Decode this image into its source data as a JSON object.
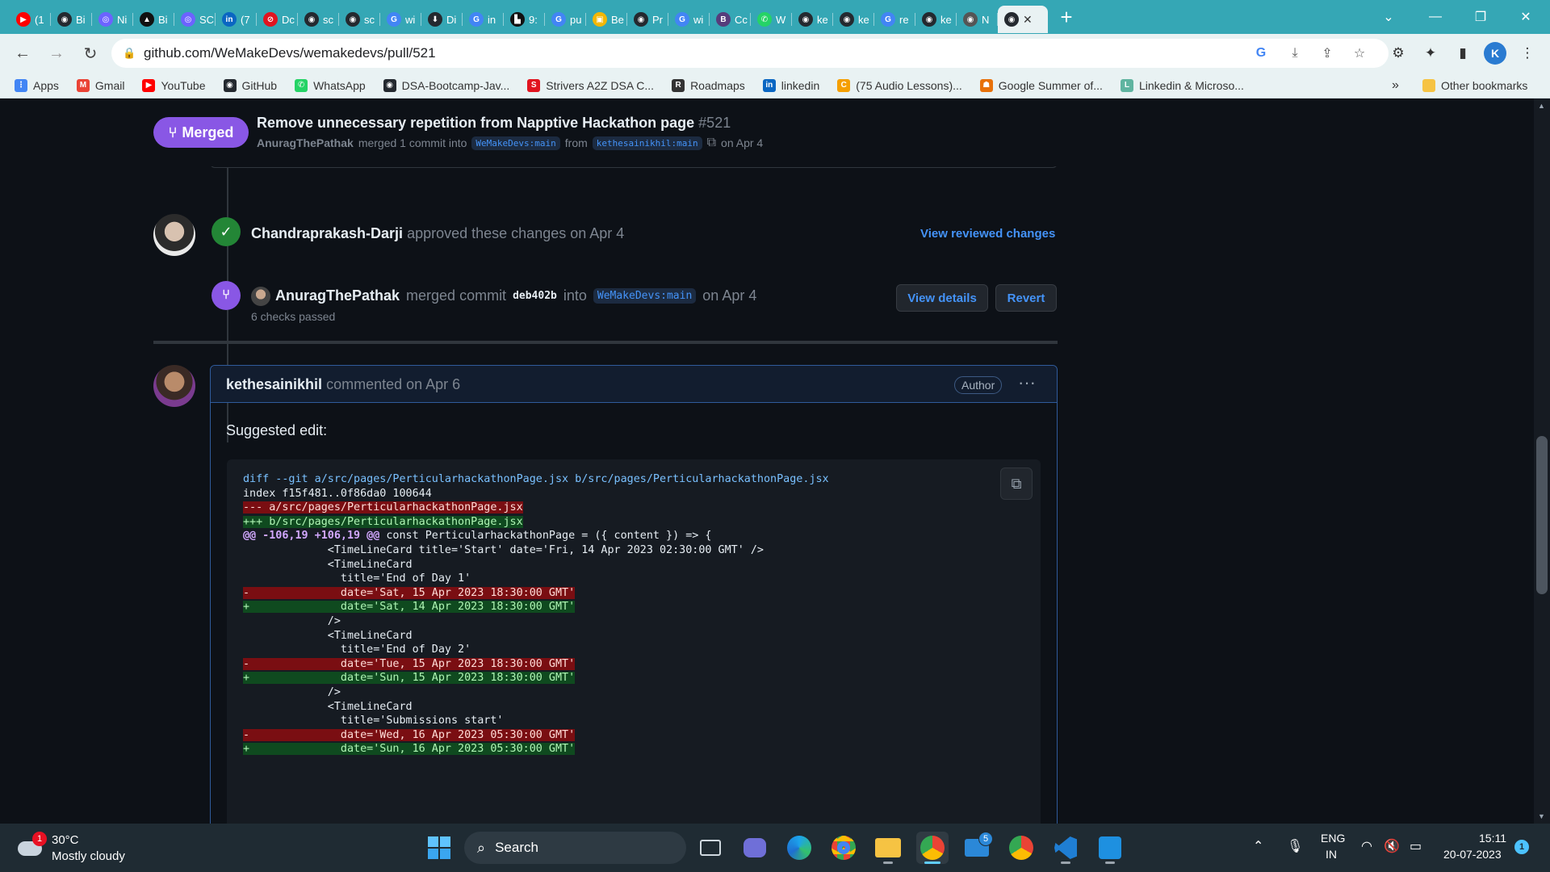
{
  "browser": {
    "tabs": [
      {
        "label": "(1",
        "color": "#ff0000",
        "glyph": "▶"
      },
      {
        "label": "Bi",
        "color": "#24292f",
        "glyph": "◉"
      },
      {
        "label": "Ni",
        "color": "#6c63ff",
        "glyph": "◎"
      },
      {
        "label": "Bi",
        "color": "#111111",
        "glyph": "▲"
      },
      {
        "label": "SC",
        "color": "#6c63ff",
        "glyph": "◎"
      },
      {
        "label": "(7",
        "color": "#0a66c2",
        "glyph": "in"
      },
      {
        "label": "Dc",
        "color": "#e1141f",
        "glyph": "⊘"
      },
      {
        "label": "sc",
        "color": "#24292f",
        "glyph": "◉"
      },
      {
        "label": "sc",
        "color": "#24292f",
        "glyph": "◉"
      },
      {
        "label": "wi",
        "color": "#4285f4",
        "glyph": "G"
      },
      {
        "label": "Di",
        "color": "#24292f",
        "glyph": "⬇"
      },
      {
        "label": "in",
        "color": "#4285f4",
        "glyph": "G"
      },
      {
        "label": "9:",
        "color": "#111111",
        "glyph": "▙"
      },
      {
        "label": "pu",
        "color": "#4285f4",
        "glyph": "G"
      },
      {
        "label": "Be",
        "color": "#f2b705",
        "glyph": "▣"
      },
      {
        "label": "Pr",
        "color": "#24292f",
        "glyph": "◉"
      },
      {
        "label": "wi",
        "color": "#4285f4",
        "glyph": "G"
      },
      {
        "label": "Cc",
        "color": "#563d7c",
        "glyph": "B"
      },
      {
        "label": "W",
        "color": "#25d366",
        "glyph": "✆"
      },
      {
        "label": "ke",
        "color": "#24292f",
        "glyph": "◉"
      },
      {
        "label": "ke",
        "color": "#24292f",
        "glyph": "◉"
      },
      {
        "label": "re",
        "color": "#4285f4",
        "glyph": "G"
      },
      {
        "label": "ke",
        "color": "#24292f",
        "glyph": "◉"
      },
      {
        "label": "N",
        "color": "#555555",
        "glyph": "◉"
      }
    ],
    "active_tab_glyph": "◉",
    "new_tab": "+",
    "url": "github.com/WeMakeDevs/wemakedevs/pull/521",
    "profile_initial": "K",
    "bookmarks": [
      {
        "label": "Apps",
        "color": "#4285f4",
        "glyph": "⋮"
      },
      {
        "label": "Gmail",
        "color": "#ea4335",
        "glyph": "M"
      },
      {
        "label": "YouTube",
        "color": "#ff0000",
        "glyph": "▶"
      },
      {
        "label": "GitHub",
        "color": "#24292f",
        "glyph": "◉"
      },
      {
        "label": "WhatsApp",
        "color": "#25d366",
        "glyph": "✆"
      },
      {
        "label": "DSA-Bootcamp-Jav...",
        "color": "#24292f",
        "glyph": "◉"
      },
      {
        "label": "Strivers A2Z DSA C...",
        "color": "#e1141f",
        "glyph": "S"
      },
      {
        "label": "Roadmaps",
        "color": "#333333",
        "glyph": "R"
      },
      {
        "label": "linkedin",
        "color": "#0a66c2",
        "glyph": "in"
      },
      {
        "label": "(75 Audio Lessons)...",
        "color": "#f59f00",
        "glyph": "C"
      },
      {
        "label": "Google Summer of...",
        "color": "#e8710a",
        "glyph": "☗"
      },
      {
        "label": "Linkedin & Microso...",
        "color": "#5fb4a0",
        "glyph": "L"
      }
    ],
    "bookmarks_overflow": "»",
    "other_bookmarks": "Other bookmarks"
  },
  "pr": {
    "state": "Merged",
    "title": "Remove unnecessary repetition from Napptive Hackathon page",
    "number": "#521",
    "author": "AnuragThePathak",
    "merged_text": "merged 1 commit into",
    "base_branch": "WeMakeDevs:main",
    "from_text": "from",
    "head_branch": "kethesainikhil:main",
    "date_text": "on Apr 4"
  },
  "timeline": {
    "approval": {
      "user": "Chandraprakash-Darji",
      "action": "approved these changes on Apr 4",
      "link": "View reviewed changes"
    },
    "merge": {
      "user": "AnuragThePathak",
      "action": "merged commit",
      "commit": "deb402b",
      "into": "into",
      "branch": "WeMakeDevs:main",
      "date": "on Apr 4",
      "checks": "6 checks passed",
      "view_details": "View details",
      "revert": "Revert"
    }
  },
  "comment": {
    "user": "kethesainikhil",
    "meta": "commented on Apr 6",
    "badge": "Author",
    "menu": "···",
    "body": "Suggested edit:",
    "code_lines": [
      {
        "type": "meta",
        "text": "diff --git a/src/pages/PerticularhackathonPage.jsx b/src/pages/PerticularhackathonPage.jsx"
      },
      {
        "type": "plain",
        "text": "index f15f481..0f86da0 100644"
      },
      {
        "type": "del",
        "text": "--- a/src/pages/PerticularhackathonPage.jsx"
      },
      {
        "type": "add",
        "text": "+++ b/src/pages/PerticularhackathonPage.jsx"
      },
      {
        "type": "hunk",
        "text": "@@ -106,19 +106,19 @@",
        "rest": " const PerticularhackathonPage = ({ content }) => {"
      },
      {
        "type": "plain",
        "text": "             <TimeLineCard title='Start' date='Fri, 14 Apr 2023 02:30:00 GMT' />"
      },
      {
        "type": "plain",
        "text": "             <TimeLineCard"
      },
      {
        "type": "plain",
        "text": "               title='End of Day 1'"
      },
      {
        "type": "del",
        "text": "-              date='Sat, 15 Apr 2023 18:30:00 GMT'"
      },
      {
        "type": "add",
        "text": "+              date='Sat, 14 Apr 2023 18:30:00 GMT'"
      },
      {
        "type": "plain",
        "text": "             />"
      },
      {
        "type": "plain",
        "text": "             <TimeLineCard"
      },
      {
        "type": "plain",
        "text": "               title='End of Day 2'"
      },
      {
        "type": "del",
        "text": "-              date='Tue, 15 Apr 2023 18:30:00 GMT'"
      },
      {
        "type": "add",
        "text": "+              date='Sun, 15 Apr 2023 18:30:00 GMT'"
      },
      {
        "type": "plain",
        "text": "             />"
      },
      {
        "type": "plain",
        "text": "             <TimeLineCard"
      },
      {
        "type": "plain",
        "text": "               title='Submissions start'"
      },
      {
        "type": "del",
        "text": "-              date='Wed, 16 Apr 2023 05:30:00 GMT'"
      },
      {
        "type": "add",
        "text": "+              date='Sun, 16 Apr 2023 05:30:00 GMT'"
      }
    ]
  },
  "taskbar": {
    "weather_temp": "30°C",
    "weather_desc": "Mostly cloudy",
    "weather_badge": "1",
    "search_label": "Search",
    "mail_badge": "5",
    "lang_top": "ENG",
    "lang_bottom": "IN",
    "time": "15:11",
    "date": "20-07-2023",
    "notif_count": "1"
  },
  "colors": {
    "merged": "#8957e5",
    "approved": "#238636",
    "link": "#4493f8",
    "tabstrip": "#35a7b5"
  }
}
